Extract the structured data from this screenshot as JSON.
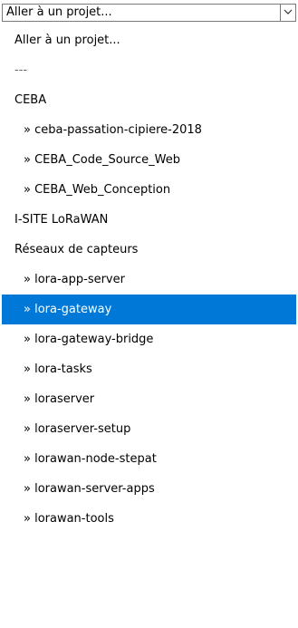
{
  "select": {
    "value": "Aller à un projet...",
    "arrow_icon": "chevron-down-icon"
  },
  "options": [
    {
      "label": "Aller à un projet...",
      "kind": "plain"
    },
    {
      "label": "---",
      "kind": "separator"
    },
    {
      "label": "CEBA",
      "kind": "plain"
    },
    {
      "label": "» ceba-passation-cipiere-2018",
      "kind": "child"
    },
    {
      "label": "» CEBA_Code_Source_Web",
      "kind": "child"
    },
    {
      "label": "» CEBA_Web_Conception",
      "kind": "child"
    },
    {
      "label": "I-SITE LoRaWAN",
      "kind": "plain"
    },
    {
      "label": "Réseaux de capteurs",
      "kind": "plain"
    },
    {
      "label": "» lora-app-server",
      "kind": "child"
    },
    {
      "label": "» lora-gateway",
      "kind": "child",
      "selected": true
    },
    {
      "label": "» lora-gateway-bridge",
      "kind": "child"
    },
    {
      "label": "» lora-tasks",
      "kind": "child"
    },
    {
      "label": "» loraserver",
      "kind": "child"
    },
    {
      "label": "» loraserver-setup",
      "kind": "child"
    },
    {
      "label": "» lorawan-node-stepat",
      "kind": "child"
    },
    {
      "label": "» lorawan-server-apps",
      "kind": "child"
    },
    {
      "label": "» lorawan-tools",
      "kind": "child"
    }
  ],
  "colors": {
    "selected_background": "#0078d7",
    "selected_text": "#ffffff",
    "border": "#7a7a7a"
  }
}
